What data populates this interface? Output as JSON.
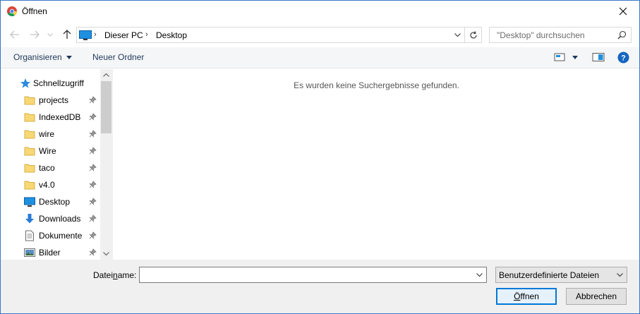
{
  "window": {
    "title": "Öffnen",
    "accent": "#0078d7"
  },
  "address": {
    "segments": [
      "Dieser PC",
      "Desktop"
    ],
    "search_placeholder": "\"Desktop\" durchsuchen"
  },
  "toolbar": {
    "organize_label": "Organisieren",
    "new_folder_label": "Neuer Ordner"
  },
  "sidebar": {
    "quick_access": "Schnellzugriff",
    "items": [
      {
        "label": "projects",
        "icon": "folder-icon"
      },
      {
        "label": "IndexedDB",
        "icon": "folder-icon"
      },
      {
        "label": "wire",
        "icon": "folder-icon"
      },
      {
        "label": "Wire",
        "icon": "folder-icon"
      },
      {
        "label": "taco",
        "icon": "folder-icon"
      },
      {
        "label": "v4.0",
        "icon": "folder-icon"
      },
      {
        "label": "Desktop",
        "icon": "desktop-icon"
      },
      {
        "label": "Downloads",
        "icon": "download-icon"
      },
      {
        "label": "Dokumente",
        "icon": "document-icon"
      },
      {
        "label": "Bilder",
        "icon": "picture-icon"
      }
    ]
  },
  "content": {
    "empty_message": "Es wurden keine Suchergebnisse gefunden."
  },
  "bottom": {
    "filename_label_pre": "Datei",
    "filename_label_u": "n",
    "filename_label_post": "ame:",
    "filename_value": "",
    "filter_value": "Benutzerdefinierte Dateien",
    "open_u": "Ö",
    "open_rest": "ffnen",
    "cancel_label": "Abbrechen"
  }
}
